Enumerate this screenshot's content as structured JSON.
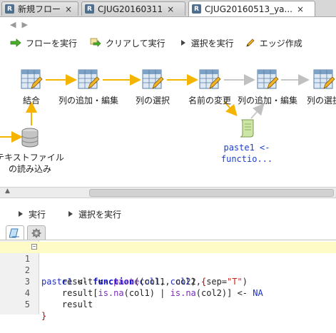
{
  "tabs": [
    {
      "label": "新規フロー",
      "close": "×",
      "active": false
    },
    {
      "label": "CJUG20160311",
      "close": "×",
      "active": false
    },
    {
      "label": "CJUG20160513_ya...",
      "close": "×",
      "active": true
    }
  ],
  "nav": {
    "back": "◀",
    "forward": "▶"
  },
  "toolbar": {
    "run_flow": "フローを実行",
    "clear_and_run": "クリアして実行",
    "run_selection": "選択を実行",
    "create_edge": "エッジ作成"
  },
  "nodes": {
    "join": "結合",
    "add_edit_1": "列の追加・編集",
    "select_cols": "列の選択",
    "rename": "名前の変更",
    "add_edit_2": "列の追加・編集",
    "select_cols_2": "列の選択",
    "read_text_1": "テキストファイル",
    "read_text_2": "の読み込み",
    "script_1": "paste1 <-",
    "script_2": "functio..."
  },
  "bottom_toolbar": {
    "run": "実行",
    "run_selection": "選択を実行"
  },
  "editor": {
    "line_numbers": [
      "1",
      "2",
      "3",
      "4",
      "5"
    ],
    "code": [
      "paste1 <- function(col1, col2) {",
      "    result <- paste(col1, col2, sep=\"T\")",
      "    result[is.na(col1) | is.na(col2)] <- NA",
      "    result",
      "}"
    ]
  },
  "colors": {
    "edge": "#f5b400",
    "edge_gray": "#c8c8c8",
    "highlight_line": "#fffbc6",
    "link_blue": "#1a3fd0"
  },
  "icons": [
    "r-file-icon",
    "run-green-arrow-icon",
    "clear-run-icon",
    "play-icon",
    "pencil-icon",
    "table-edit-icon",
    "database-icon",
    "script-scroll-icon",
    "gear-icon",
    "edit-tab-icon"
  ]
}
